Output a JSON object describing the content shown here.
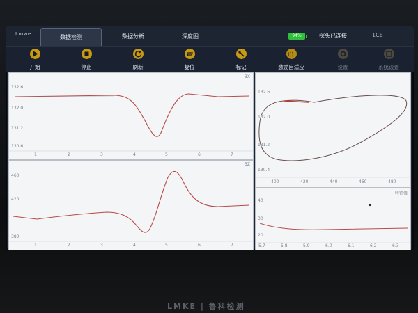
{
  "app": {
    "brand": "Lmwe"
  },
  "tabs": [
    {
      "label": "数据检测",
      "active": true
    },
    {
      "label": "数据分析",
      "active": false
    },
    {
      "label": "深度图",
      "active": false
    }
  ],
  "status": {
    "battery": "94%",
    "probe": "探头已连接",
    "extra": "1CE"
  },
  "toolbar": [
    {
      "label": "开始",
      "icon": "play-icon"
    },
    {
      "label": "停止",
      "icon": "stop-icon"
    },
    {
      "label": "刷新",
      "icon": "refresh-icon"
    },
    {
      "label": "复位",
      "icon": "reset-icon"
    },
    {
      "label": "标记",
      "icon": "mark-icon"
    },
    {
      "label": "激励自适应",
      "icon": "excitation-adapt-icon"
    },
    {
      "label": "设置",
      "icon": "settings-icon"
    },
    {
      "label": "系统设置",
      "icon": "system-settings-icon"
    }
  ],
  "panels": {
    "bx": {
      "title": "BX",
      "y_ticks": [
        "132.6",
        "132.0",
        "131.2",
        "130.6"
      ],
      "x_ticks": [
        "1",
        "2",
        "3",
        "4",
        "5",
        "6",
        "7"
      ]
    },
    "bz": {
      "title": "BZ",
      "y_ticks": [
        "460",
        "420",
        "380"
      ],
      "x_ticks": [
        "1",
        "2",
        "3",
        "4",
        "5",
        "6",
        "7"
      ]
    },
    "butterfly": {
      "y_ticks": [
        "132.6",
        "132.0",
        "131.2",
        "130.4"
      ],
      "x_ticks": [
        "400",
        "420",
        "440",
        "460",
        "480"
      ]
    },
    "depth": {
      "title": "特征值",
      "y_ticks": [
        "40",
        "30",
        "20"
      ],
      "x_ticks": [
        "5.7",
        "5.8",
        "5.9",
        "6.0",
        "6.1",
        "6.2",
        "6.3"
      ]
    }
  },
  "footer": {
    "logo": "LMKE | 鲁科检测"
  }
}
